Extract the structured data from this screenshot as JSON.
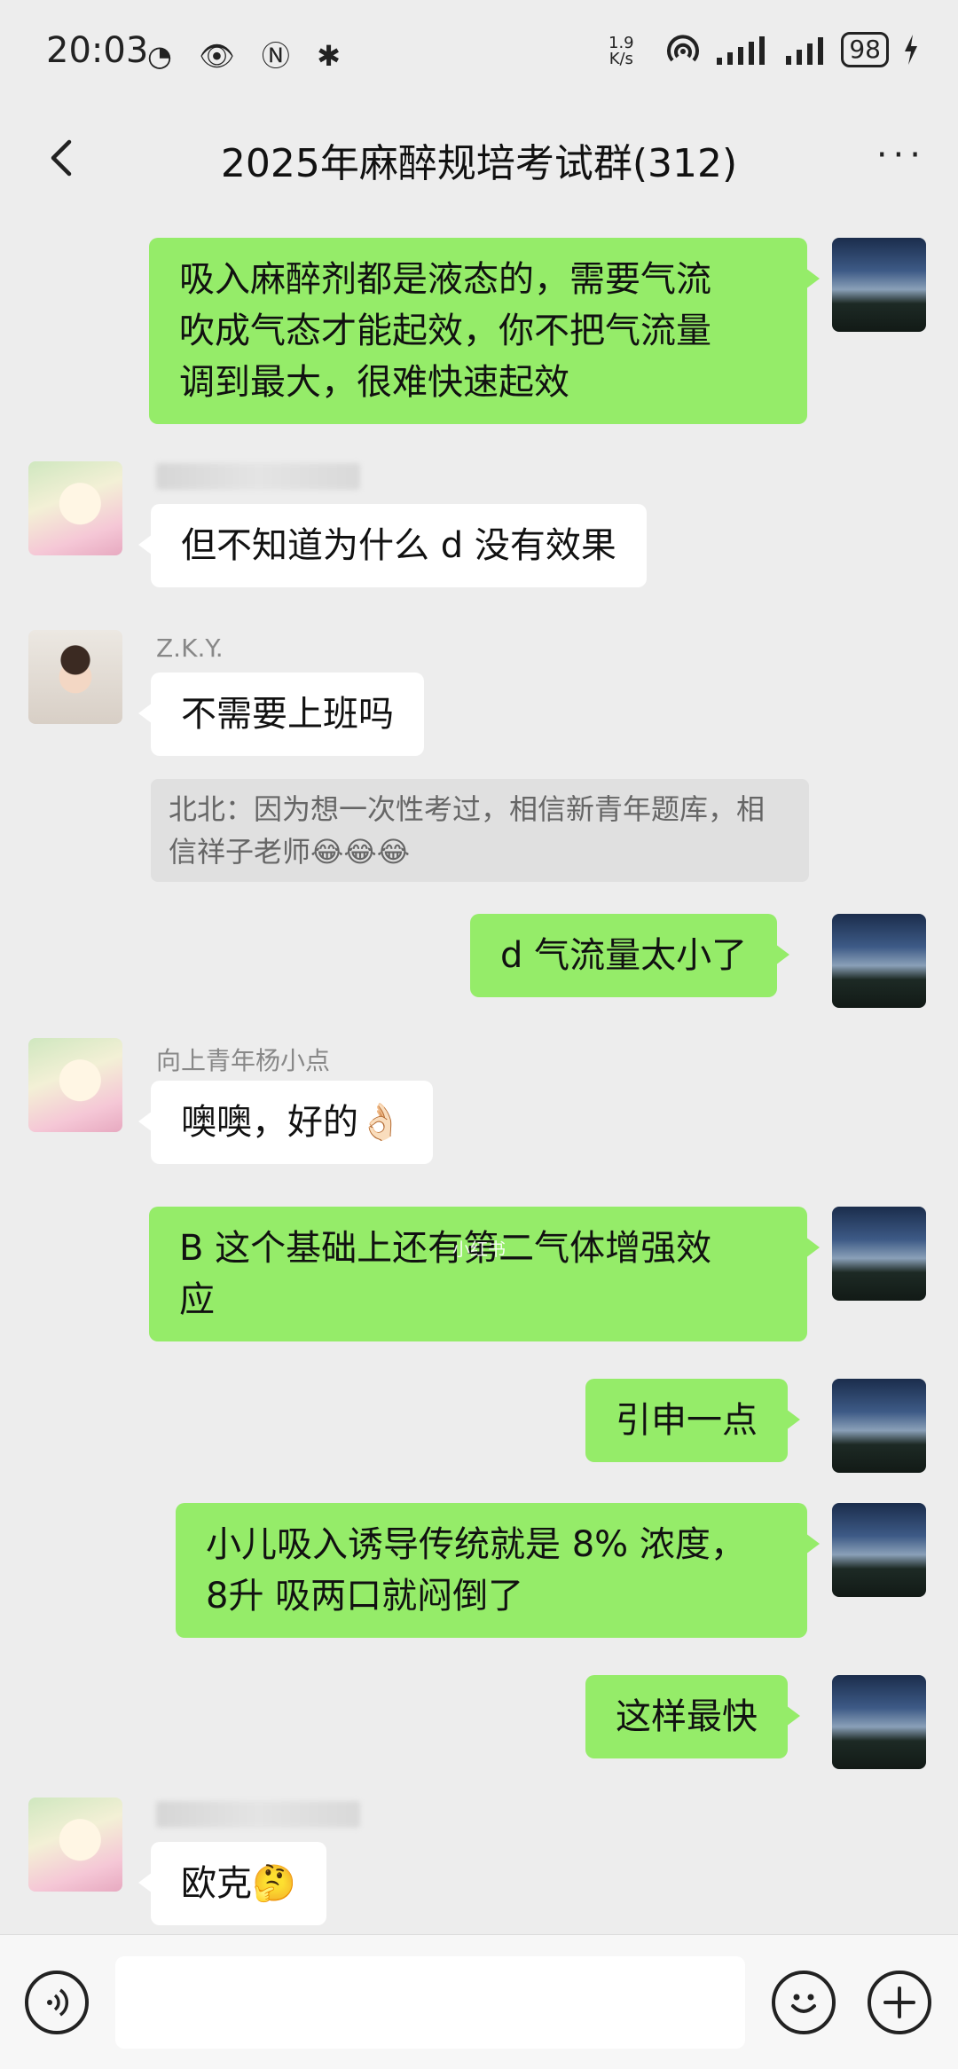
{
  "status_bar": {
    "time": "20:03",
    "left_icons": "◔ 👁 Ⓝ ✱",
    "net_speed_value": "1.9",
    "net_speed_unit": "K/s",
    "battery": "98"
  },
  "header": {
    "title": "2025年麻醉规培考试群(312)",
    "more": "···"
  },
  "messages": [
    {
      "side": "self",
      "text": "吸入麻醉剂都是液态的，需要气流\n吹成气态才能起效，你不把气流量\n调到最大，很难快速起效"
    },
    {
      "side": "other",
      "sender": "",
      "text": "但不知道为什么 d 没有效果"
    },
    {
      "side": "other",
      "sender": "Z.K.Y.",
      "text": "不需要上班吗",
      "quote": "北北：因为想一次性考过，相信新青年题库，相信祥子老师😂😂😂"
    },
    {
      "side": "self",
      "text": "d 气流量太小了"
    },
    {
      "side": "other",
      "sender": "向上青年杨小点",
      "text": "噢噢，好的👌🏻"
    },
    {
      "side": "self",
      "text": "B 这个基础上还有第二气体增强效\n应"
    },
    {
      "side": "self",
      "text": "引申一点"
    },
    {
      "side": "self",
      "text": "小儿吸入诱导传统就是 8% 浓度，\n8升 吸两口就闷倒了"
    },
    {
      "side": "self",
      "text": "这样最快"
    },
    {
      "side": "other",
      "sender": "",
      "text": "欧克🤔"
    }
  ],
  "watermark": "小红书",
  "input_bar": {
    "voice_icon": "voice-icon",
    "emoji_icon": "emoji-icon",
    "plus_icon": "plus-icon"
  },
  "colors": {
    "self_bubble": "#95ec69",
    "other_bubble": "#ffffff",
    "background": "#ededed"
  }
}
